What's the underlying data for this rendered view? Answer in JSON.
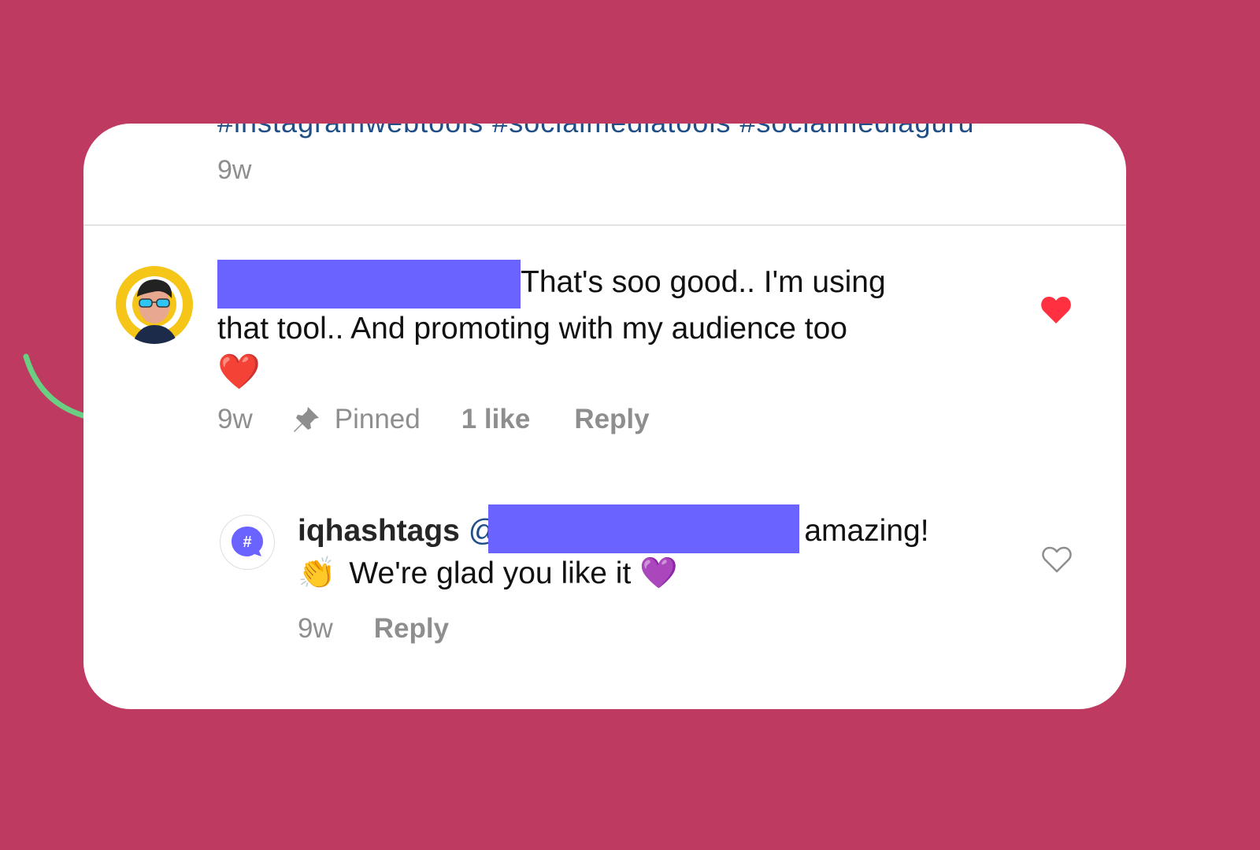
{
  "colors": {
    "background": "#BF3A60",
    "card": "#FFFFFF",
    "redaction": "#6B63FF",
    "meta_text": "#8E8E8E",
    "like_red": "#FF3040",
    "arrow_green": "#6BCF83",
    "link_blue": "#1F4F86"
  },
  "previous_comment": {
    "clipped_text": "#instagramwebtools #socialmediatools #socialmediaguru",
    "time": "9w"
  },
  "comment": {
    "avatar_icon": "cartoon-avatar-sunglasses",
    "username_redacted": true,
    "text_line1": "That's soo good.. I'm using",
    "text_line2": "that tool.. And promoting with my audience too",
    "emoji": "❤️",
    "time": "9w",
    "pin_icon": "pin-icon",
    "pinned_label": "Pinned",
    "likes_label": "1 like",
    "reply_label": "Reply",
    "liked": true
  },
  "reply": {
    "avatar_icon": "hashtag-chat-logo",
    "username": "iqhashtags",
    "mention_prefix": "@",
    "text_after_mention": "amazing!",
    "emoji_clap": "👏",
    "text_line2": "We're glad you like it",
    "emoji_heart": "💜",
    "time": "9w",
    "reply_label": "Reply",
    "liked": false
  }
}
